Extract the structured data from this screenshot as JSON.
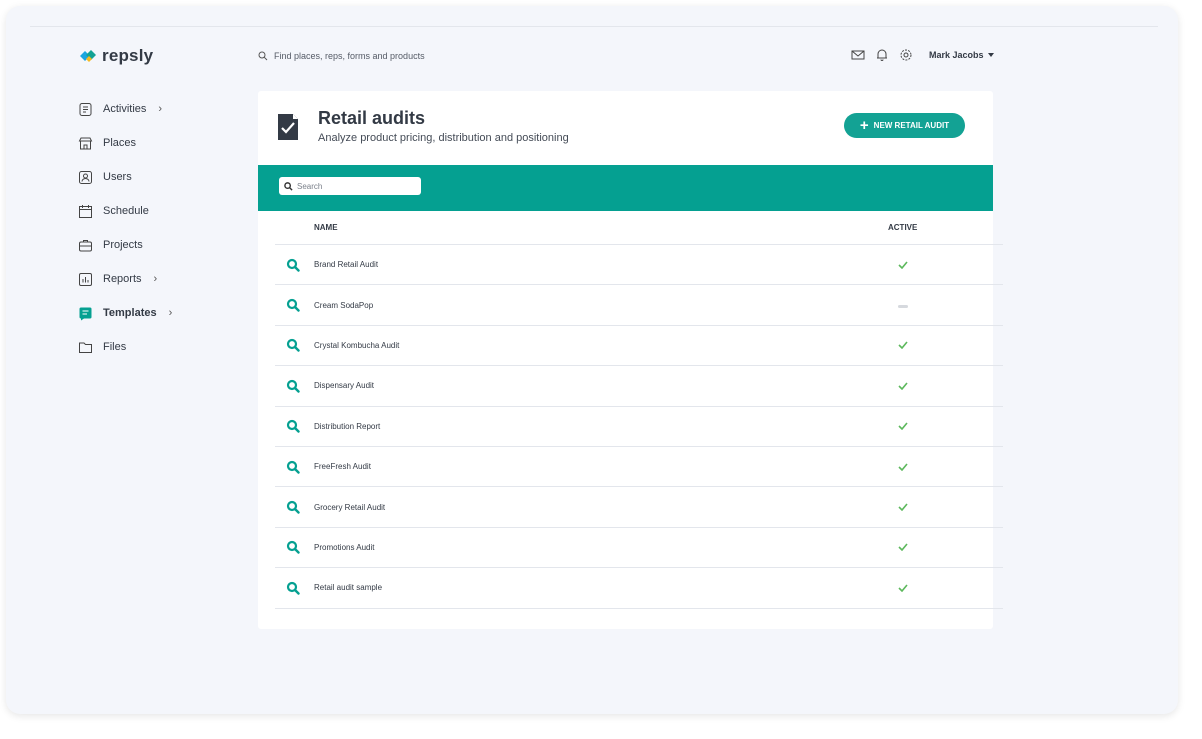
{
  "brand": {
    "name": "repsly"
  },
  "header": {
    "search_placeholder": "Find places, reps, forms and products",
    "user_name": "Mark Jacobs"
  },
  "sidebar": {
    "items": [
      {
        "label": "Activities",
        "icon": "clipboard-icon",
        "chevron": "›"
      },
      {
        "label": "Places",
        "icon": "store-icon"
      },
      {
        "label": "Users",
        "icon": "user-icon"
      },
      {
        "label": "Schedule",
        "icon": "calendar-icon"
      },
      {
        "label": "Projects",
        "icon": "briefcase-icon"
      },
      {
        "label": "Reports",
        "icon": "chart-icon",
        "chevron": "›"
      },
      {
        "label": "Templates",
        "icon": "template-icon",
        "chevron": "›",
        "active": true
      },
      {
        "label": "Files",
        "icon": "folder-icon"
      }
    ]
  },
  "page": {
    "title": "Retail audits",
    "subtitle": "Analyze product pricing, distribution and positioning",
    "new_button": "NEW RETAIL AUDIT",
    "search_placeholder": "Search"
  },
  "table": {
    "columns": {
      "name": "NAME",
      "active": "ACTIVE"
    },
    "rows": [
      {
        "name": "Brand Retail Audit",
        "active": true
      },
      {
        "name": "Cream SodaPop",
        "active": false
      },
      {
        "name": "Crystal Kombucha Audit",
        "active": true
      },
      {
        "name": "Dispensary Audit",
        "active": true
      },
      {
        "name": "Distribution Report",
        "active": true
      },
      {
        "name": "FreeFresh Audit",
        "active": true
      },
      {
        "name": "Grocery Retail Audit",
        "active": true
      },
      {
        "name": "Promotions Audit",
        "active": true
      },
      {
        "name": "Retail audit sample",
        "active": true
      }
    ]
  },
  "colors": {
    "accent": "#05a091",
    "check": "#5cb85c",
    "text": "#333a45"
  }
}
